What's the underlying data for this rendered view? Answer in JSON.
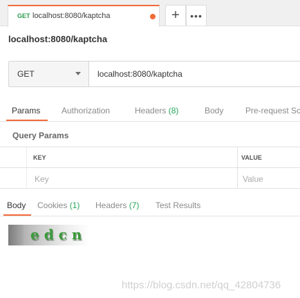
{
  "tab": {
    "method": "GET",
    "url": "localhost:8080/kaptcha"
  },
  "request_name": "localhost:8080/kaptcha",
  "url_bar": {
    "method": "GET",
    "url": "localhost:8080/kaptcha"
  },
  "request_tabs": {
    "params": "Params",
    "authorization": "Authorization",
    "headers": "Headers",
    "headers_count": "(8)",
    "body": "Body",
    "pre_request": "Pre-request Sc"
  },
  "query_params": {
    "title": "Query Params",
    "key_header": "KEY",
    "value_header": "VALUE",
    "key_placeholder": "Key",
    "value_placeholder": "Value"
  },
  "response_tabs": {
    "body": "Body",
    "cookies": "Cookies",
    "cookies_count": "(1)",
    "headers": "Headers",
    "headers_count": "(7)",
    "test_results": "Test Results"
  },
  "captcha_text": "edcn",
  "watermark": "https://blog.csdn.net/qq_42804736",
  "colors": {
    "accent": "#f26b3a",
    "get_method": "#2a9c4c",
    "count": "#26a55a"
  }
}
